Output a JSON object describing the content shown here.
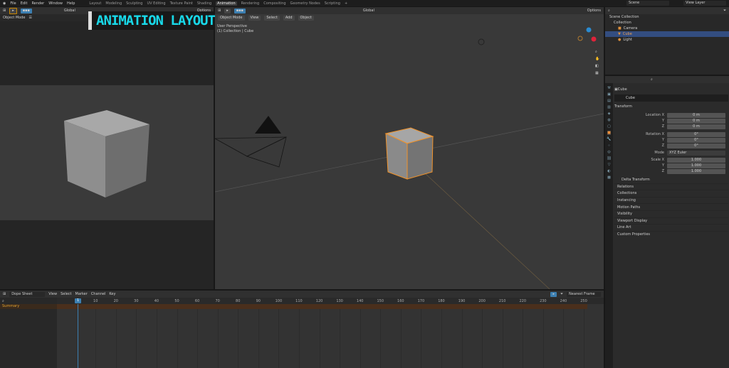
{
  "menu": [
    "File",
    "Edit",
    "Render",
    "Window",
    "Help"
  ],
  "workspaces": [
    "Layout",
    "Modeling",
    "Sculpting",
    "UV Editing",
    "Texture Paint",
    "Shading",
    "Animation",
    "Rendering",
    "Compositing",
    "Geometry Nodes",
    "Scripting",
    "+"
  ],
  "active_workspace": "Animation",
  "scene": "Scene",
  "view_layer": "View Layer",
  "left_view": {
    "transform": "Global",
    "options": "Options",
    "mode": "Object Mode"
  },
  "overlay_title": "ANIMATION LAYOUT ↑",
  "main_view": {
    "mode": "Object Mode",
    "menus": [
      "View",
      "Select",
      "Add",
      "Object"
    ],
    "transform": "Global",
    "options": "Options",
    "perspective": "User Perspective",
    "collection": "(1) Collection | Cube"
  },
  "outliner": {
    "items": [
      "Scene Collection",
      "Collection",
      "Camera",
      "Cube",
      "Light"
    ],
    "selected": "Cube"
  },
  "properties": {
    "object": "Cube",
    "datablock": "Cube",
    "section": "Transform",
    "location": {
      "label": "Location X",
      "x": "0 m",
      "y": "0 m",
      "z": "0 m"
    },
    "rotation": {
      "label": "Rotation X",
      "x": "0°",
      "y": "0°",
      "z": "0°"
    },
    "mode_label": "Mode",
    "mode": "XYZ Euler",
    "scale": {
      "label": "Scale X",
      "x": "1.000",
      "y": "1.000",
      "z": "1.000"
    },
    "axis": {
      "y": "Y",
      "z": "Z"
    },
    "delta": "Delta Transform",
    "sections": [
      "Relations",
      "Collections",
      "Instancing",
      "Motion Paths",
      "Visibility",
      "Viewport Display",
      "Line Art",
      "Custom Properties"
    ]
  },
  "dopesheet": {
    "mode": "Dope Sheet",
    "menus": [
      "View",
      "Select",
      "Marker",
      "Channel",
      "Key"
    ],
    "snap": "Nearest Frame",
    "summary": "Summary",
    "current_frame": "1",
    "ticks": [
      "10",
      "20",
      "30",
      "40",
      "50",
      "60",
      "70",
      "80",
      "90",
      "100",
      "110",
      "120",
      "130",
      "140",
      "150",
      "160",
      "170",
      "180",
      "190",
      "200",
      "210",
      "220",
      "230",
      "240",
      "250"
    ]
  }
}
